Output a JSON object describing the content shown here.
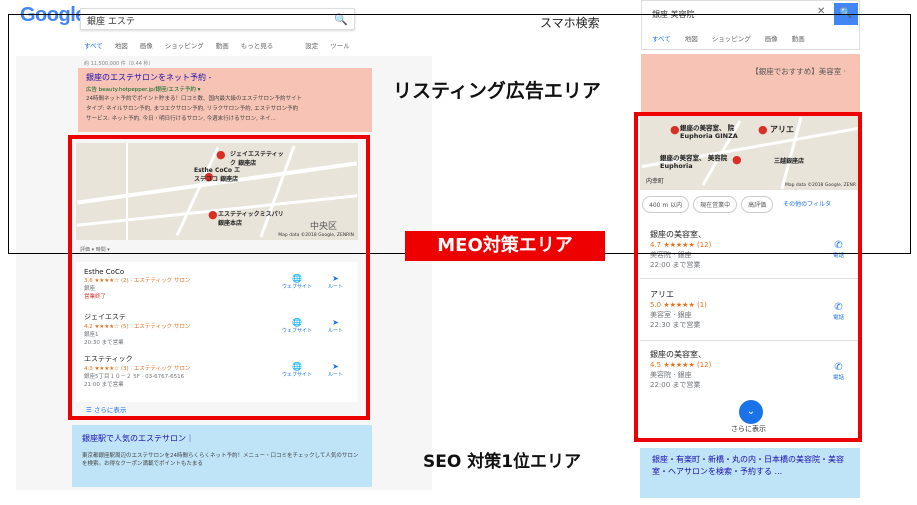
{
  "desktop": {
    "logo": "Google",
    "search_value": "銀座 エステ",
    "tabs": [
      "すべて",
      "地図",
      "画像",
      "ショッピング",
      "動画",
      "もっと見る",
      "設定",
      "ツール"
    ],
    "result_count": "約 11,500,000 件（0.44 秒）",
    "ad": {
      "title": "銀座のエステサロンをネット予約 -",
      "url": "広告 beauty.hotpepper.jp/銀座/エステ予約 ▾",
      "desc": "24時間ネット予約でポイント貯まる！口コミ数、国内最大級のエステサロン予約サイト",
      "desc2": "タイプ: ネイルサロン予約, まつエクサロン予約, リラクサロン予約, エステサロン予約",
      "desc3": "サービス: ネット予約, 今日・明日行けるサロン, 今週末行けるサロン, ネイ..."
    },
    "map": {
      "labels": [
        "ジェイエステティック 銀座店",
        "Esthe CoCo エステココ 銀座店",
        "エステティックミスパリ 銀座本店",
        "中央区"
      ],
      "credit": "Map data ©2018 Google, ZENRIN"
    },
    "filters": "評価 ▾   時間 ▾",
    "listings": [
      {
        "name": "Esthe CoCo",
        "rating": "3.6 ★★★★☆ (2) · エステティック サロン",
        "extra": "銀座",
        "status": "営業終了"
      },
      {
        "name": "ジェイエステ",
        "rating": "4.2 ★★★★☆ (5) · エステティック サロン",
        "extra": "銀座1",
        "status": "20:30 まで営業"
      },
      {
        "name": "エステティック",
        "rating": "4.3 ★★★★☆ (3) · エステティック サロン",
        "extra": "銀座5丁目１０－２ 5F · 03-6767-6516",
        "status": "21:00 まで営業"
      }
    ],
    "action_website": "ウェブサイト",
    "action_route": "ルート",
    "more": "☰ さらに表示",
    "seo": {
      "title": "銀座駅で人気のエステサロン｜",
      "desc": "東京都銀座駅周辺のエステサロンを24時間らくらくネット予約！メニュー・口コミをチェックして人気のサロンを検索。お得なクーポン満載でポイントもたまる"
    }
  },
  "mobile": {
    "search_value": "銀座 美容院",
    "tabs": [
      "すべて",
      "地図",
      "ショッピング",
      "画像",
      "動画"
    ],
    "ad_title": "【銀座でおすすめ】美容室 ·",
    "map_labels": [
      "銀座の美容室、 院 Euphoria GINZA",
      "アリエ",
      "銀座の美容室、 美容院 Euphoria",
      "三越銀座店",
      "内幸町"
    ],
    "map_credit": "Map data ©2018 Google, ZENR",
    "chips": [
      "400 m 以内",
      "現在営業中",
      "高評価",
      "その他のフィルタ"
    ],
    "listings": [
      {
        "name": "銀座の美容室、",
        "rating": "4.7 ★★★★★ (12)",
        "type": "美容院 · 銀座",
        "status": "22:00 まで営業"
      },
      {
        "name": "アリエ",
        "rating": "5.0 ★★★★★ (1)",
        "type": "美容室 · 銀座",
        "status": "22:30 まで営業"
      },
      {
        "name": "銀座の美容室、",
        "rating": "4.5 ★★★★★ (12)",
        "type": "美容院 · 銀座",
        "status": "22:00 まで営業"
      }
    ],
    "call_label": "電話",
    "more": "さらに表示",
    "seo_text": "銀座・有楽町・新橋・丸の内・日本橋の美容院・美容室・ヘアサロンを検索・予約する ..."
  },
  "labels": {
    "smartphone": "スマホ検索",
    "listing_area": "リスティング広告エリア",
    "meo_area": "MEO対策エリア",
    "seo_area": "SEO 対策1位エリア"
  },
  "colors": {
    "listing_bg": "#f6c3b5",
    "seo_bg": "#bfe3f7",
    "meo_red": "#e00000",
    "link_blue": "#1a0dab"
  }
}
